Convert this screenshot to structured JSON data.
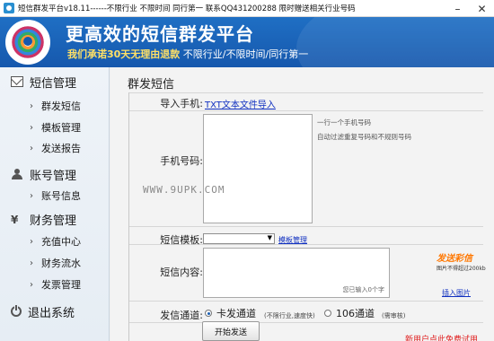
{
  "window": {
    "title": "短信群发平台v18.11------不限行业 不限时间 同行第一   联系QQ431200288 限时赠送相关行业号码",
    "minimize": "–",
    "close": "✕"
  },
  "banner": {
    "headline": "更高效的短信群发平台",
    "slogan_highlight": "我们承诺30天无理由退款",
    "slogan_rest": " 不限行业/不限时间/同行第一"
  },
  "sidebar": {
    "groups": [
      {
        "label": "短信管理",
        "icon": "mail-icon",
        "items": [
          "群发短信",
          "模板管理",
          "发送报告"
        ]
      },
      {
        "label": "账号管理",
        "icon": "user-icon",
        "items": [
          "账号信息"
        ]
      },
      {
        "label": "财务管理",
        "icon": "yen-icon",
        "items": [
          "充值中心",
          "财务流水",
          "发票管理"
        ]
      },
      {
        "label": "退出系统",
        "icon": "power-icon",
        "items": []
      }
    ]
  },
  "main": {
    "page_title": "群发短信",
    "import_label": "导入手机:",
    "import_link": "TXT文本文件导入",
    "phone_label": "手机号码:",
    "phone_hint_1": "一行一个手机号码",
    "phone_hint_2": "自动过滤重复号码和不规则号码",
    "watermark": "WWW.9UPK.COM",
    "template_label": "短信模板:",
    "template_selected": "",
    "template_manage": "模板管理",
    "content_label": "短信内容:",
    "content_counter": "您已输入0个字",
    "promo_title": "发送彩信",
    "promo_sub": "图片不得超过200kb",
    "insert_image": "插入图片",
    "channel_label": "发信通道:",
    "channel_options": [
      {
        "label": "卡发通道",
        "note": "(不限行业,速度快)",
        "selected": true
      },
      {
        "label": "106通道",
        "note": "(需审核)",
        "selected": false
      }
    ],
    "send_button": "开始发送",
    "promo_bottom": "新用户点此免费试用"
  },
  "colors": {
    "banner_blue": "#1a63b8",
    "link_blue": "#1030c0",
    "promo_orange": "#ff7700",
    "promo_red": "#e02020"
  }
}
